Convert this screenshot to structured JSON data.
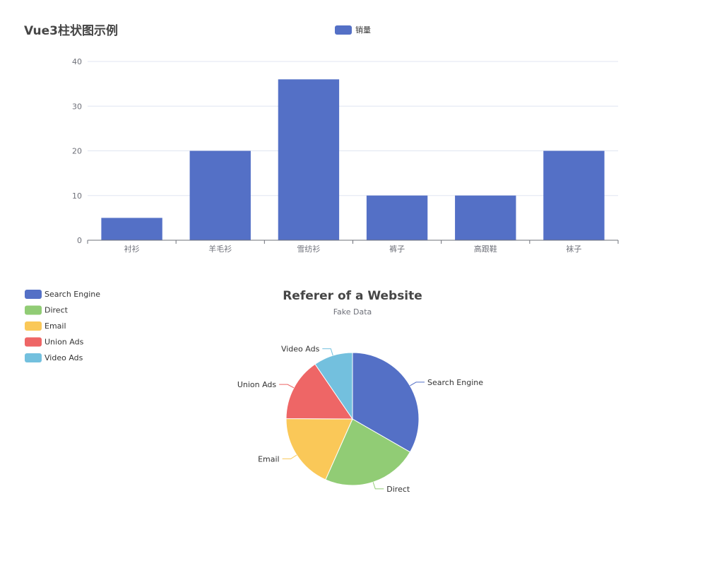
{
  "chart_data": [
    {
      "type": "bar",
      "title": "Vue3柱状图示例",
      "categories": [
        "衬衫",
        "羊毛衫",
        "雪纺衫",
        "裤子",
        "高跟鞋",
        "袜子"
      ],
      "series": [
        {
          "name": "销量",
          "values": [
            5,
            20,
            36,
            10,
            10,
            20
          ],
          "color": "#5470c6"
        }
      ],
      "ylim": [
        0,
        40
      ],
      "yticks": [
        0,
        10,
        20,
        30,
        40
      ],
      "grid": true,
      "legend_position": "top-center"
    },
    {
      "type": "pie",
      "title": "Referer of a Website",
      "subtitle": "Fake Data",
      "legend_position": "top-left",
      "slices": [
        {
          "name": "Search Engine",
          "value": 1048,
          "color": "#5470c6"
        },
        {
          "name": "Direct",
          "value": 735,
          "color": "#91cc75"
        },
        {
          "name": "Email",
          "value": 580,
          "color": "#fac858"
        },
        {
          "name": "Union Ads",
          "value": 484,
          "color": "#ee6666"
        },
        {
          "name": "Video Ads",
          "value": 300,
          "color": "#73c0de"
        }
      ]
    }
  ]
}
